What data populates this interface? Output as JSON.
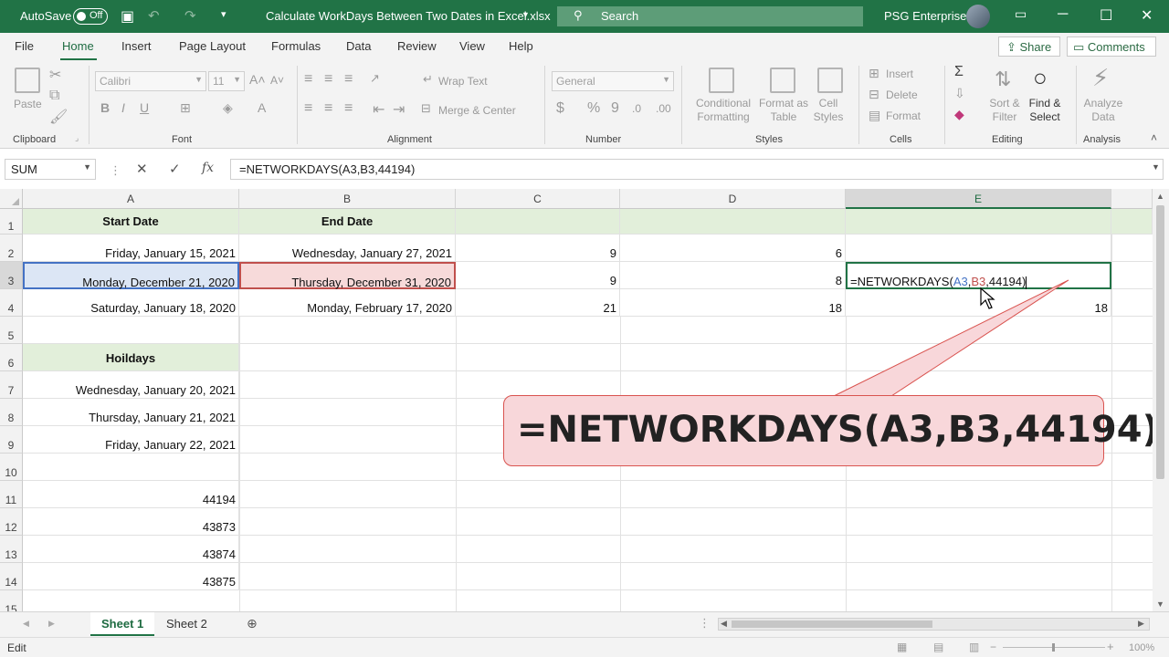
{
  "title_bar": {
    "autosave_label": "AutoSave",
    "autosave_state": "Off",
    "file_name": "Calculate WorkDays Between Two Dates in Excel.xlsx",
    "search_placeholder": "Search",
    "user_name": "PSG Enterprises"
  },
  "ribbon_tabs": [
    "File",
    "Home",
    "Insert",
    "Page Layout",
    "Formulas",
    "Data",
    "Review",
    "View",
    "Help"
  ],
  "active_tab": "Home",
  "share_label": "Share",
  "comments_label": "Comments",
  "ribbon": {
    "clipboard": {
      "group": "Clipboard",
      "paste": "Paste"
    },
    "font": {
      "group": "Font",
      "font_name": "Calibri",
      "font_size": "11"
    },
    "alignment": {
      "group": "Alignment",
      "wrap_text": "Wrap Text",
      "merge_center": "Merge & Center"
    },
    "number": {
      "group": "Number",
      "format": "General"
    },
    "styles": {
      "group": "Styles",
      "conditional_formatting": "Conditional Formatting",
      "format_as_table": "Format as Table",
      "cell_styles": "Cell Styles"
    },
    "cells": {
      "group": "Cells",
      "insert": "Insert",
      "delete": "Delete",
      "format": "Format"
    },
    "editing": {
      "group": "Editing",
      "sort_filter": "Sort & Filter",
      "find_select": "Find & Select"
    },
    "analysis": {
      "group": "Analysis",
      "analyze_data": "Analyze Data"
    }
  },
  "formula_bar": {
    "name_box": "SUM",
    "formula": "=NETWORKDAYS(A3,B3,44194)"
  },
  "columns": [
    "A",
    "B",
    "C",
    "D",
    "E"
  ],
  "rows": [
    "1",
    "2",
    "3",
    "4",
    "5",
    "6",
    "7",
    "8",
    "9",
    "10",
    "11",
    "12",
    "13",
    "14",
    "15"
  ],
  "cells": {
    "A1": "Start Date",
    "B1": "End Date",
    "A2": "Friday, January 15, 2021",
    "B2": "Wednesday, January 27, 2021",
    "C2": "9",
    "D2": "6",
    "A3": "Monday, December 21, 2020",
    "B3": "Thursday, December 31, 2020",
    "C3": "9",
    "D3": "8",
    "E3_prefix": "=NETWORKDAYS(",
    "E3_ref1": "A3",
    "E3_comma1": ",",
    "E3_ref2": "B3",
    "E3_suffix": ",44194)",
    "A4": "Saturday, January 18, 2020",
    "B4": "Monday, February 17, 2020",
    "C4": "21",
    "D4": "18",
    "E4": "18",
    "A6": "Hoildays",
    "A7": "Wednesday, January 20, 2021",
    "A8": "Thursday, January 21, 2021",
    "A9": "Friday, January 22, 2021",
    "A11": "44194",
    "A12": "43873",
    "A13": "43874",
    "A14": "43875"
  },
  "callout_text": "=NETWORKDAYS(A3,B3,44194)",
  "sheets": [
    "Sheet 1",
    "Sheet 2"
  ],
  "active_sheet": "Sheet 1",
  "status_mode": "Edit",
  "zoom": "100%",
  "colors": {
    "excel_green": "#217346",
    "header_fill": "#e2efda",
    "ref_blue": "#4472c4",
    "ref_red": "#c0504d",
    "callout_fill": "#f8d7da"
  }
}
